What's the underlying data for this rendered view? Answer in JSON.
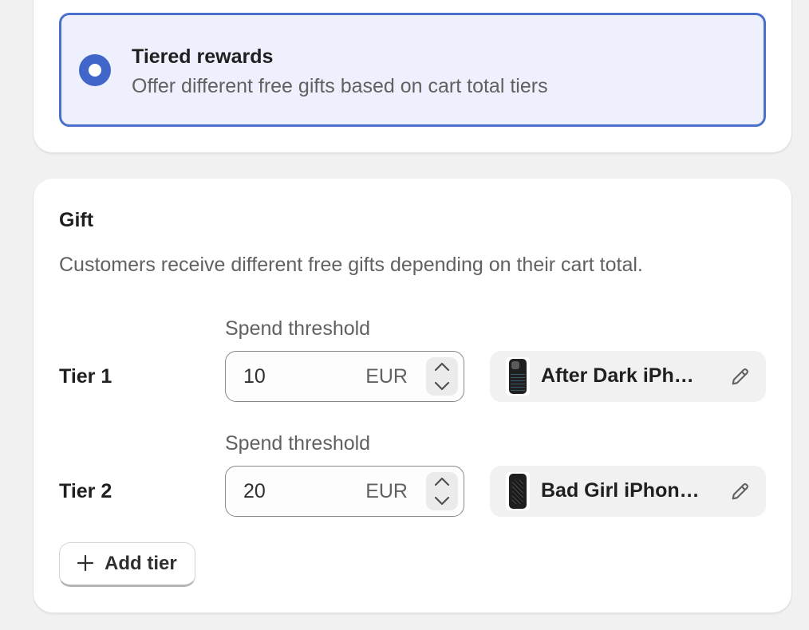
{
  "reward_option": {
    "title": "Tiered rewards",
    "description": "Offer different free gifts based on cart total tiers",
    "selected": true
  },
  "gift": {
    "title": "Gift",
    "description": "Customers receive different free gifts depending on their cart total.",
    "tiers": [
      {
        "label": "Tier 1",
        "threshold_label": "Spend threshold",
        "threshold_value": "10",
        "currency": "EUR",
        "product_name": "After Dark iPhone Case",
        "product_icon": "phone-case-thumbnail-icon"
      },
      {
        "label": "Tier 2",
        "threshold_label": "Spend threshold",
        "threshold_value": "20",
        "currency": "EUR",
        "product_name": "Bad Girl iPhone Case",
        "product_icon": "phone-case-thumbnail-icon"
      }
    ],
    "add_tier_label": "Add tier"
  },
  "colors": {
    "accent": "#3f66c8",
    "selected_bg": "#eef1fd",
    "page_bg": "#f1f1f1"
  }
}
